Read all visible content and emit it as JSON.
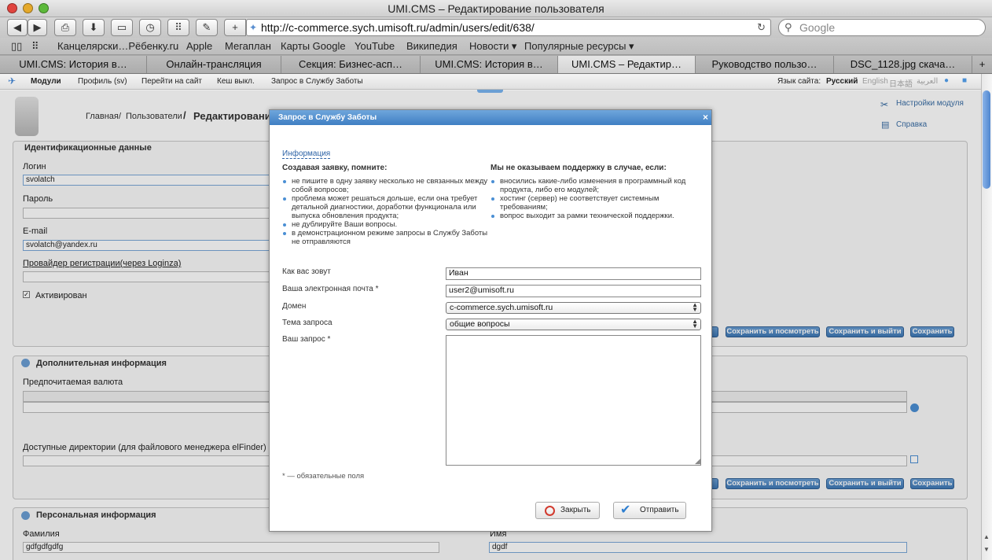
{
  "window": {
    "title": "UMI.CMS – Редактирование пользователя"
  },
  "browser": {
    "url": "http://c-commerce.sych.umisoft.ru/admin/users/edit/638/",
    "search_placeholder": "Google",
    "bookmarks": [
      "Канцелярски…Рёбенку.ru",
      "Apple",
      "Мегаплан",
      "Карты Google",
      "YouTube",
      "Википедия",
      "Новости ▾",
      "Популярные ресурсы ▾"
    ],
    "tabs": [
      {
        "label": "UMI.CMS: История в…"
      },
      {
        "label": "Онлайн-трансляция"
      },
      {
        "label": "Секция: Бизнес-асп…"
      },
      {
        "label": "UMI.CMS: История в…"
      },
      {
        "label": "UMI.CMS – Редактир…"
      },
      {
        "label": "Руководство пользо…"
      },
      {
        "label": "DSC_1128.jpg скача…"
      }
    ],
    "new_tab": "+"
  },
  "cmsbar": {
    "modules": "Модули",
    "profile": "Профиль (sv)",
    "go_site": "Перейти на сайт",
    "cache": "Кеш выкл.",
    "support": "Запрос в Службу Заботы",
    "site_lang_label": "Язык сайта:",
    "langs": [
      "Русский",
      "English",
      "日本語",
      "العربية"
    ]
  },
  "page": {
    "breadcrumb_home": "Главная",
    "breadcrumb_sep": "/",
    "breadcrumb_users": "Пользователи",
    "breadcrumb_sep2": "/",
    "title": "Редактирование",
    "module_settings": "Настройки модуля",
    "help": "Справка",
    "ident_section": "Идентификационные данные",
    "login_label": "Логин",
    "login_value": "svolatch",
    "password_label": "Пароль",
    "email_label": "E-mail",
    "email_value": "svolatch@yandex.ru",
    "provider_label": "Провайдер регистрации(через Loginza)",
    "active_label": "Активирован",
    "extra_section": "Дополнительная информация",
    "currency_label": "Предпочитаемая валюта",
    "dirs_label": "Доступные директории (для файлового менеджера elFinder)",
    "personal_section": "Персональная информация",
    "surname_label": "Фамилия",
    "surname_value": "gdfgdfgdfg",
    "name_label": "Имя",
    "name_value": "dgdf",
    "btn_save_view": "Сохранить и посмотреть",
    "btn_save_exit": "Сохранить и выйти",
    "btn_save": "Сохранить"
  },
  "modal": {
    "title": "Запрос в Службу Заботы",
    "close": "×",
    "info_link": "Информация",
    "left_heading": "Создавая заявку, помните:",
    "left_items": [
      "не пишите в одну заявку несколько не связанных между собой вопросов;",
      "проблема может решаться дольше, если она требует детальной диагностики, доработки функционала или выпуска обновления продукта;",
      "не дублируйте Ваши вопросы.",
      "в демонстрационном режиме запросы в Службу Заботы не отправляются"
    ],
    "right_heading": "Мы не оказываем поддержку в случае, если:",
    "right_items": [
      "вносились какие-либо изменения в программный код продукта, либо его модулей;",
      "хостинг (сервер) не соответствует системным требованиям;",
      "вопрос выходит за рамки технической поддержки."
    ],
    "name_label": "Как вас зовут",
    "name_value": "Иван",
    "email_label": "Ваша электронная почта *",
    "email_value": "user2@umisoft.ru",
    "domain_label": "Домен",
    "domain_value": "c-commerce.sych.umisoft.ru",
    "topic_label": "Тема запроса",
    "topic_value": "общие вопросы",
    "request_label": "Ваш запрос *",
    "request_value": "",
    "required_note": "* — обязательные поля",
    "btn_close": "Закрыть",
    "btn_send": "Отправить"
  }
}
